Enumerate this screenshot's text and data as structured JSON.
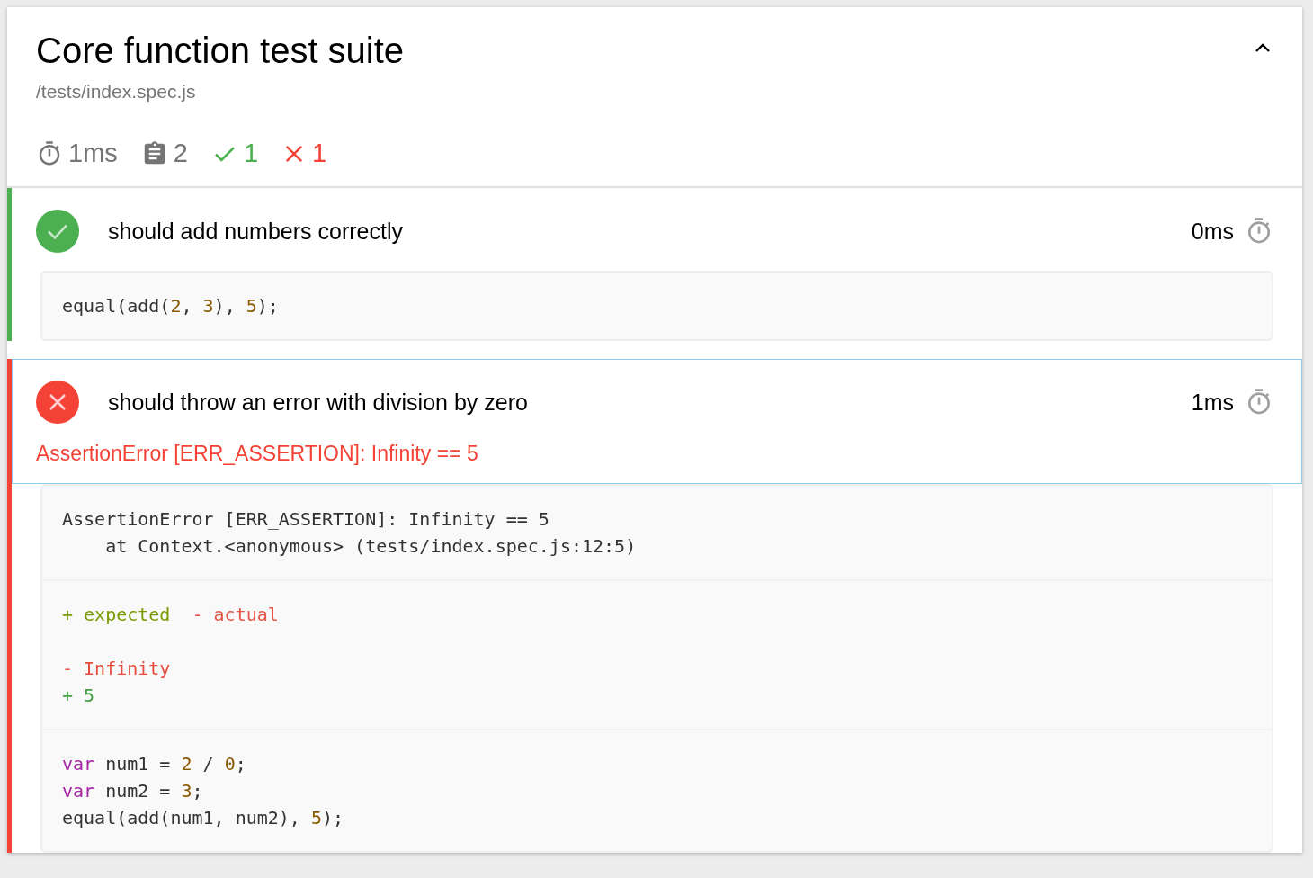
{
  "suite": {
    "title": "Core function test suite",
    "path": "/tests/index.spec.js",
    "expanded": true,
    "stats": [
      {
        "kind": "duration",
        "text": "1ms"
      },
      {
        "kind": "total",
        "text": "2"
      },
      {
        "kind": "passed",
        "text": "1"
      },
      {
        "kind": "failed",
        "text": "1"
      }
    ]
  },
  "tests": [
    {
      "title": "should add numbers correctly",
      "kind": "passed",
      "duration": "0ms",
      "highlighted": false,
      "sections": [
        {
          "paragraphs": [
            [
              {
                "tokens": [
                  {
                    "kind": "plain",
                    "text": "equal(add("
                  },
                  {
                    "kind": "number",
                    "text": "2"
                  },
                  {
                    "kind": "plain",
                    "text": ", "
                  },
                  {
                    "kind": "number",
                    "text": "3"
                  },
                  {
                    "kind": "plain",
                    "text": "), "
                  },
                  {
                    "kind": "number",
                    "text": "5"
                  },
                  {
                    "kind": "plain",
                    "text": ");"
                  }
                ]
              }
            ]
          ]
        }
      ]
    },
    {
      "title": "should throw an error with division by zero",
      "kind": "failed",
      "duration": "1ms",
      "highlighted": true,
      "error": "AssertionError [ERR_ASSERTION]: Infinity == 5",
      "sections": [
        {
          "paragraphs": [
            [
              {
                "tokens": [
                  {
                    "kind": "plain",
                    "text": "AssertionError [ERR_ASSERTION]: Infinity == 5"
                  }
                ]
              },
              {
                "tokens": [
                  {
                    "kind": "plain",
                    "text": "    at Context.<anonymous> (tests/index.spec.js:12:5)"
                  }
                ]
              }
            ]
          ]
        },
        {
          "paragraphs": [
            [
              {
                "tokens": [
                  {
                    "kind": "expected",
                    "text": "+ expected  "
                  },
                  {
                    "kind": "actual",
                    "text": "- actual"
                  }
                ]
              }
            ],
            [
              {
                "tokens": [
                  {
                    "kind": "removed",
                    "text": "- Infinity"
                  }
                ]
              },
              {
                "tokens": [
                  {
                    "kind": "added",
                    "text": "+ 5"
                  }
                ]
              }
            ]
          ]
        },
        {
          "paragraphs": [
            [
              {
                "tokens": [
                  {
                    "kind": "keyword",
                    "text": "var"
                  },
                  {
                    "kind": "plain",
                    "text": " num1 = "
                  },
                  {
                    "kind": "number",
                    "text": "2"
                  },
                  {
                    "kind": "plain",
                    "text": " / "
                  },
                  {
                    "kind": "number",
                    "text": "0"
                  },
                  {
                    "kind": "plain",
                    "text": ";"
                  }
                ]
              },
              {
                "tokens": [
                  {
                    "kind": "keyword",
                    "text": "var"
                  },
                  {
                    "kind": "plain",
                    "text": " num2 = "
                  },
                  {
                    "kind": "number",
                    "text": "3"
                  },
                  {
                    "kind": "plain",
                    "text": ";"
                  }
                ]
              },
              {
                "tokens": [
                  {
                    "kind": "plain",
                    "text": "equal(add(num1, num2), "
                  },
                  {
                    "kind": "number",
                    "text": "5"
                  },
                  {
                    "kind": "plain",
                    "text": ");"
                  }
                ]
              }
            ]
          ]
        }
      ]
    }
  ]
}
